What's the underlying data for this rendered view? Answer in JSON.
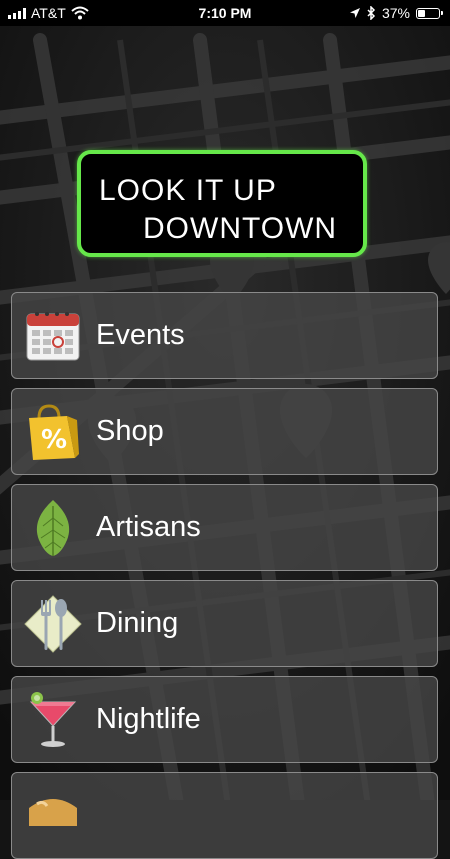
{
  "status_bar": {
    "carrier": "AT&T",
    "time": "7:10 PM",
    "battery_percent": "37%",
    "battery_level": 0.37,
    "icons": [
      "signal-icon",
      "wifi-icon",
      "location-icon",
      "bluetooth-icon",
      "battery-icon"
    ]
  },
  "logo": {
    "line1": "LOOK IT UP",
    "line2": "DOWNTOWN",
    "border_color": "#66e84a"
  },
  "menu": {
    "items": [
      {
        "label": "Events",
        "icon": "calendar-icon"
      },
      {
        "label": "Shop",
        "icon": "shopping-bag-icon"
      },
      {
        "label": "Artisans",
        "icon": "leaf-icon"
      },
      {
        "label": "Dining",
        "icon": "fork-spoon-icon"
      },
      {
        "label": "Nightlife",
        "icon": "cocktail-icon"
      },
      {
        "label": "",
        "icon": "bread-icon"
      }
    ]
  },
  "colors": {
    "accent": "#66e84a",
    "background": "#141414",
    "menu_item_bg": "#464646"
  }
}
